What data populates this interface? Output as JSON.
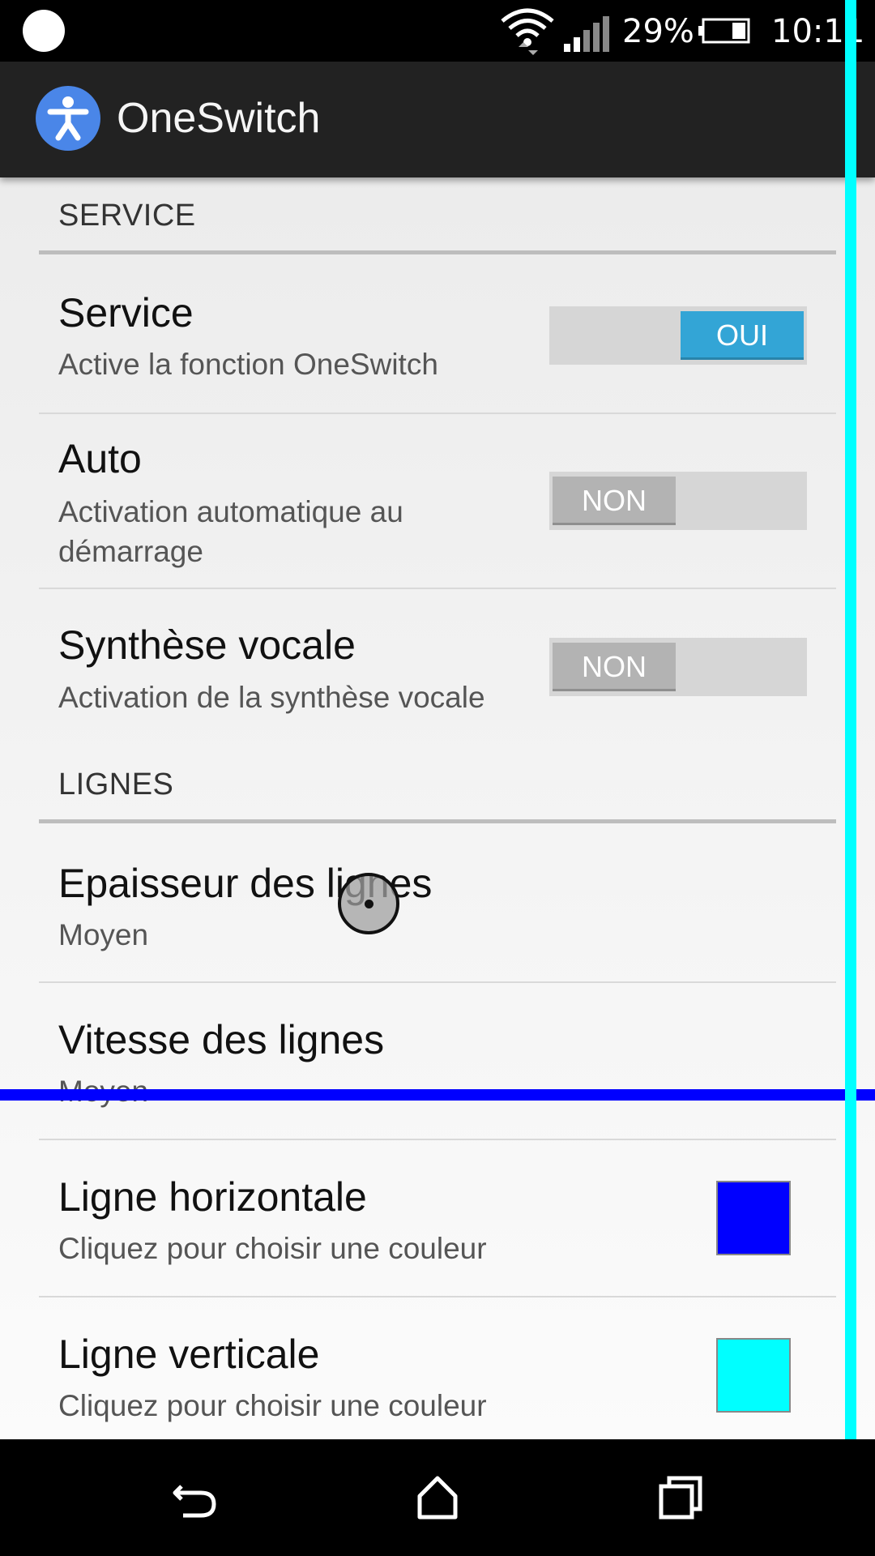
{
  "status_bar": {
    "battery_percent": "29%",
    "time": "10:11",
    "icons": [
      "notification-dot-icon",
      "wifi-icon",
      "cell-signal-icon",
      "battery-icon"
    ]
  },
  "app_bar": {
    "title": "OneSwitch",
    "icon": "accessibility-person-icon",
    "icon_color": "#4a86e8"
  },
  "sections": {
    "service": {
      "header": "SERVICE",
      "items": [
        {
          "title": "Service",
          "subtitle": "Active la fonction OneSwitch",
          "toggle_label": "OUI",
          "toggle_on": true
        },
        {
          "title": "Auto",
          "subtitle_line1": "Activation automatique au",
          "subtitle_line2": "démarrage",
          "toggle_label": "NON",
          "toggle_on": false
        },
        {
          "title": "Synthèse vocale",
          "subtitle": "Activation de la synthèse vocale",
          "toggle_label": "NON",
          "toggle_on": false
        }
      ]
    },
    "lignes": {
      "header": "LIGNES",
      "items": [
        {
          "title": "Epaisseur des lignes",
          "subtitle": "Moyen"
        },
        {
          "title": "Vitesse des lignes",
          "subtitle": "Moyen"
        },
        {
          "title": "Ligne horizontale",
          "subtitle": "Cliquez pour choisir une couleur",
          "color": "#0000ff"
        },
        {
          "title": "Ligne verticale",
          "subtitle": "Cliquez pour choisir une couleur",
          "color": "#00ffff"
        }
      ]
    }
  },
  "overlays": {
    "horizontal_line_color": "#0000ff",
    "vertical_line_color": "#00ffff"
  },
  "nav_bar": {
    "buttons": [
      "back-icon",
      "home-icon",
      "recents-icon"
    ]
  },
  "colors": {
    "toggle_on": "#33a5d6",
    "toggle_off": "#b3b3b3"
  }
}
